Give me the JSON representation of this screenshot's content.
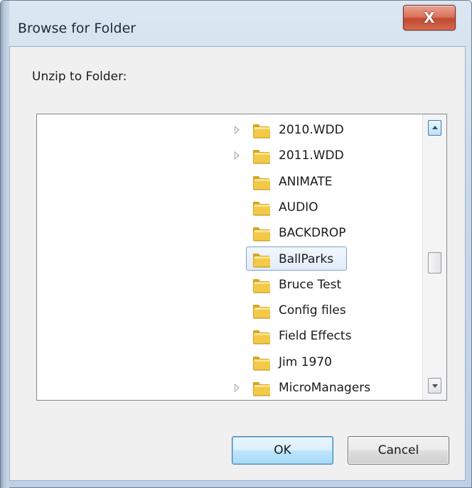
{
  "window": {
    "title": "Browse for Folder",
    "close_glyph": "X"
  },
  "dialog": {
    "prompt": "Unzip to Folder:"
  },
  "tree": {
    "items": [
      {
        "label": "2010.WDD",
        "has_children": true,
        "selected": false,
        "icon": "folder-icon"
      },
      {
        "label": "2011.WDD",
        "has_children": true,
        "selected": false,
        "icon": "folder-icon"
      },
      {
        "label": "ANIMATE",
        "has_children": false,
        "selected": false,
        "icon": "folder-icon"
      },
      {
        "label": "AUDIO",
        "has_children": false,
        "selected": false,
        "icon": "folder-icon"
      },
      {
        "label": "BACKDROP",
        "has_children": false,
        "selected": false,
        "icon": "folder-icon"
      },
      {
        "label": "BallParks",
        "has_children": false,
        "selected": true,
        "icon": "folder-icon"
      },
      {
        "label": "Bruce Test",
        "has_children": false,
        "selected": false,
        "icon": "folder-icon"
      },
      {
        "label": "Config files",
        "has_children": false,
        "selected": false,
        "icon": "folder-icon"
      },
      {
        "label": "Field Effects",
        "has_children": false,
        "selected": false,
        "icon": "folder-icon"
      },
      {
        "label": "Jim 1970",
        "has_children": false,
        "selected": false,
        "icon": "folder-icon"
      },
      {
        "label": "MicroManagers",
        "has_children": true,
        "selected": false,
        "icon": "folder-icon"
      }
    ]
  },
  "buttons": {
    "ok_label": "OK",
    "cancel_label": "Cancel"
  },
  "colors": {
    "selection_border": "#7da2ce",
    "close_button": "#c24a31",
    "default_button_border": "#3c7fb1"
  }
}
